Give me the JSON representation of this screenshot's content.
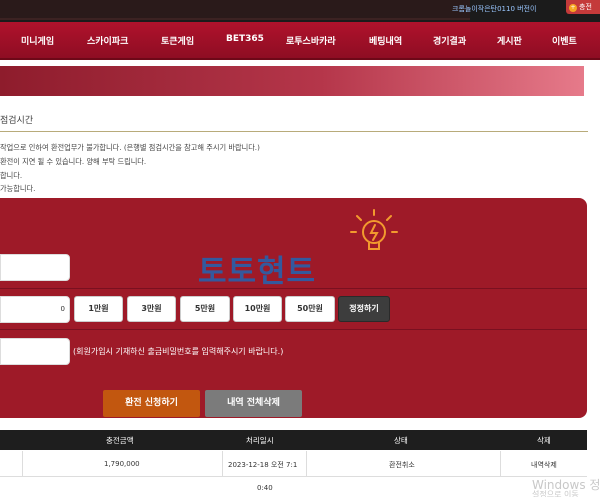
{
  "topbar": {
    "user_text": "크롬놀이작은탄0110 버전이",
    "charge_label": "충전"
  },
  "nav": {
    "items": [
      "미니게임",
      "스카이파크",
      "토큰게임",
      "BET365",
      "로투스바카라",
      "베팅내역",
      "경기결과",
      "게시판",
      "이벤트"
    ]
  },
  "section": {
    "title": "점검시간",
    "notices": [
      "작업으로 인하여 환전업무가 불가합니다. (은행별 점검시간을 참고해 주시기 바랍니다.)",
      "환전이 지연 될 수 있습니다. 양해 부탁 드립니다.",
      "합니다.",
      "가능합니다."
    ]
  },
  "form": {
    "amount_value": "0",
    "amount_buttons": [
      "1만원",
      "3만원",
      "5만원",
      "10만원",
      "50만원"
    ],
    "reset_label": "정정하기",
    "password_note": "(회원가입시 기재하신 출금비밀번호를 입력해주시기 바랍니다.)",
    "watermark": "토토현트"
  },
  "actions": {
    "apply_label": "환전 신청하기",
    "delete_all_label": "내역 전체삭제"
  },
  "table": {
    "headers": [
      "충전금액",
      "처리일시",
      "상태",
      "삭제"
    ],
    "rows": [
      {
        "amount": "1,790,000",
        "datetime": "2023-12-18 오전 7:1",
        "status": "환전취소",
        "delete": "내역삭제"
      }
    ]
  },
  "footer": {
    "timer": "0:40",
    "windows_line1": "Windows 정",
    "windows_line2": "설정으로 이동"
  },
  "colors": {
    "nav_bg": "#a0102a",
    "panel_bg": "#9e1a28",
    "apply_btn": "#c2570f",
    "delete_btn": "#7b7b7b",
    "table_header": "#1e1e1e"
  }
}
